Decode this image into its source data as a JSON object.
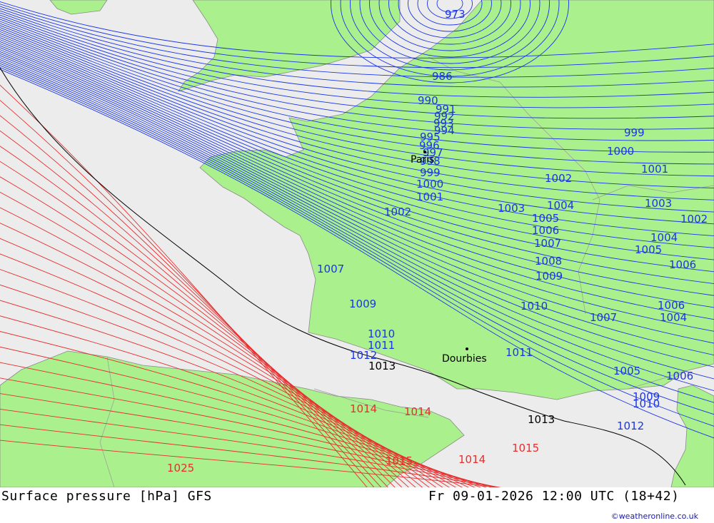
{
  "colors": {
    "sea": "#ececec",
    "land": "#aaf08c",
    "low_isobar": "#1a35e6",
    "high_isobar": "#e62e2e",
    "reference_isobar": "#000000",
    "border": "#9a9a9a"
  },
  "places": [
    {
      "name": "Paris",
      "icon": "city-dot"
    },
    {
      "name": "Dourbies",
      "icon": "city-dot"
    }
  ],
  "isobar_labels": {
    "low": [
      "973",
      "986",
      "990",
      "991",
      "992",
      "993",
      "994",
      "995",
      "996",
      "997",
      "998",
      "999",
      "1000",
      "1001",
      "1002",
      "1003",
      "1004",
      "1005",
      "1006",
      "1007",
      "1008",
      "1009",
      "1010",
      "1011",
      "1012"
    ],
    "reference": [
      "1013"
    ],
    "high": [
      "1014",
      "1015",
      "1025"
    ]
  },
  "footer": {
    "title": "Surface pressure [hPa] GFS",
    "valid_time": "Fr 09-01-2026 12:00 UTC (18+42)",
    "credit": "©weatheronline.co.uk"
  }
}
